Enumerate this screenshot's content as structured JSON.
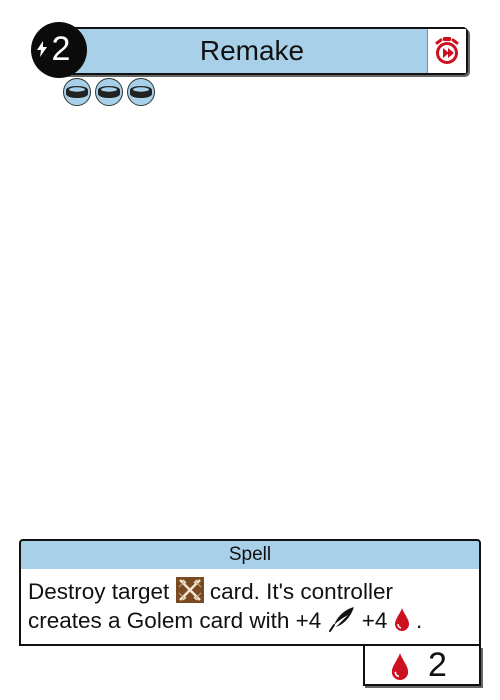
{
  "card": {
    "cost": "2",
    "title": "Remake",
    "type": "Spell",
    "rules": {
      "part1": "Destroy target",
      "part2": "card. It's controller creates a Golem card with +4",
      "part3": "+4",
      "part4": "."
    },
    "stat_value": "2",
    "token_count": 3,
    "icons": {
      "cost": "lightning-icon",
      "speed": "fast-stopwatch-icon",
      "token": "coin-token-icon",
      "target_type": "crossed-swords-icon",
      "stat_feather": "feather-icon",
      "stat_blood": "blood-drop-icon"
    },
    "colors": {
      "header": "#a8d0e8",
      "cost_badge": "#0b0b0b",
      "blood": "#cc1020",
      "swords_bg": "#7a4a22"
    }
  }
}
